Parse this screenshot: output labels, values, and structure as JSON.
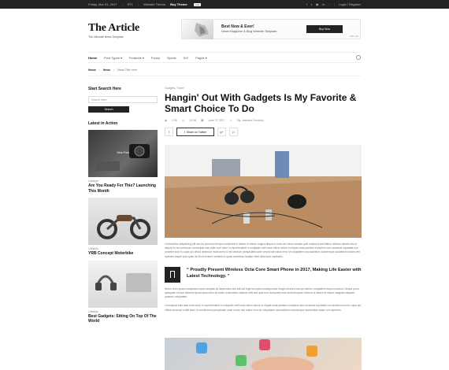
{
  "topbar": {
    "date": "Friday, Mar 31, 2017",
    "rtl": "RTL",
    "website_theme": "Website Theme",
    "buy": "Buy Theme",
    "badge": "new",
    "login": "Login / Register"
  },
  "logo": {
    "title": "The Article",
    "tagline": "The Ultimate News Template"
  },
  "ad": {
    "title": "Best Now & Ever!",
    "subtitle": "News Magazine & Blog Website Template.",
    "button": "Buy Now",
    "size": "728 x 90"
  },
  "nav": {
    "items": [
      "Home",
      "Post Types ▾",
      "Features ▾",
      "Funny",
      "Sports",
      "DIY",
      "Pages ▾"
    ]
  },
  "breadcrumb": {
    "home": "Home",
    "news": "News",
    "current": "News Title Here"
  },
  "sidebar": {
    "search_title": "Start Search Here",
    "search_placeholder": "Search Here",
    "search_button": "Search",
    "latest_title": "Latest in Action",
    "cards": [
      {
        "category": "Lifestyle",
        "title": "Are You Ready For This? Launching This Month",
        "view": "View Post"
      },
      {
        "category": "Lifestyle",
        "title": "YRB Concept Motorbike"
      },
      {
        "category": "Lifestyle",
        "title": "Best Gadgets: Sitting On Top Of The World"
      }
    ]
  },
  "article": {
    "category": "Gadgets, Travel",
    "title": "Hangin' Out With Gadgets Is My Favorite & Smart Choice To Do",
    "meta": {
      "views": "2.9K",
      "time": "12:36",
      "date": "June 27 2017",
      "author": "By: Jasmine Soushey"
    },
    "share_twitter": "Share on Twitter",
    "para1": "Consectetur adipisicing elit sed do eiusmod tempor incididunt ut labore et dolore magna aliqua ut enim ad minim veniam quis nostrud exercitation ullamco laboris nisi ut aliquip ex ea commodo consequat duis aute irure dolor in reprehenderit in voluptate velit esse cillum dolore eu fugiat nulla pariatur excepteur sint occaecat cupidatat non proident sunt in culpa qui officia deserunt mollit anim id est laborum perspiciatis unde omnis iste natus error sit voluptatem accusantium doloremque laudantium totam rem aperiam eaque ipsa quae ab illo inventore veritatis et quasi architecto beatae vitae dicta sunt explicabo.",
    "quote": "“ Proudly Present Wireless Octa Core Smart Phone in 2017, Making Life Easier with Latest Technology. ”",
    "para2": "Nemo enim ipsam voluptatem quia voluptas sit aspernatur aut odit aut fugit sed quia consequuntur magni dolores eos qui ratione voluptatem sequi nesciunt. Neque porro quisquam est qui dolorem ipsum quia dolor sit amet consectetur adipisci velit sed quia non numquam eius modi tempora incidunt ut labore et dolore magnam aliquam quaerat voluptatem.",
    "para3": "Consequat duis aute irure dolor in reprehenderit in voluptate velit esse cillum dolore eu fugiat nulla pariatur excepteur sint occaecat cupidatat non proident sunt in culpa qui officia deserunt mollit anim id est laborum perspiciatis unde omnis iste natus error sit voluptatem accusantium doloremque laudantium totam rem aperiam."
  },
  "colors": {
    "dark": "#222222",
    "accent_text": "#111111"
  }
}
